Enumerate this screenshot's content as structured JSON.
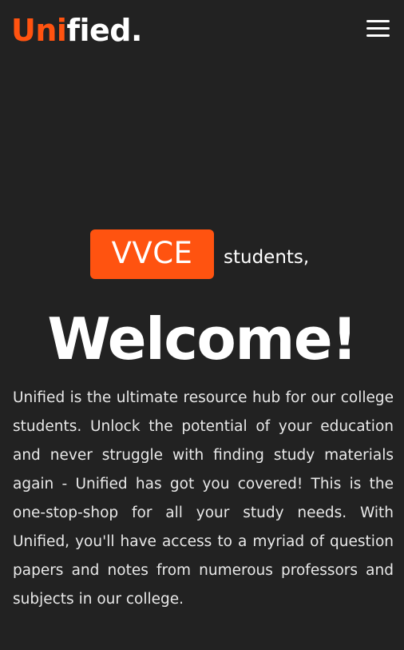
{
  "header": {
    "logo_accent": "Uni",
    "logo_rest": "fied.",
    "menu_icon": "hamburger-menu-icon"
  },
  "hero": {
    "badge_label": "VVCE",
    "badge_suffix": "students,",
    "heading": "Welcome!",
    "description": "Unified is the ultimate resource hub for our college students. Unlock the potential of your education and never struggle with finding study materials again - Unified has got you covered! This is the one-stop-shop for all your study needs. With Unified, you'll have access to a myriad of question papers and notes from numerous professors and subjects in our college."
  },
  "colors": {
    "background": "#222222",
    "accent": "#ff5310",
    "text": "#ffffff"
  }
}
